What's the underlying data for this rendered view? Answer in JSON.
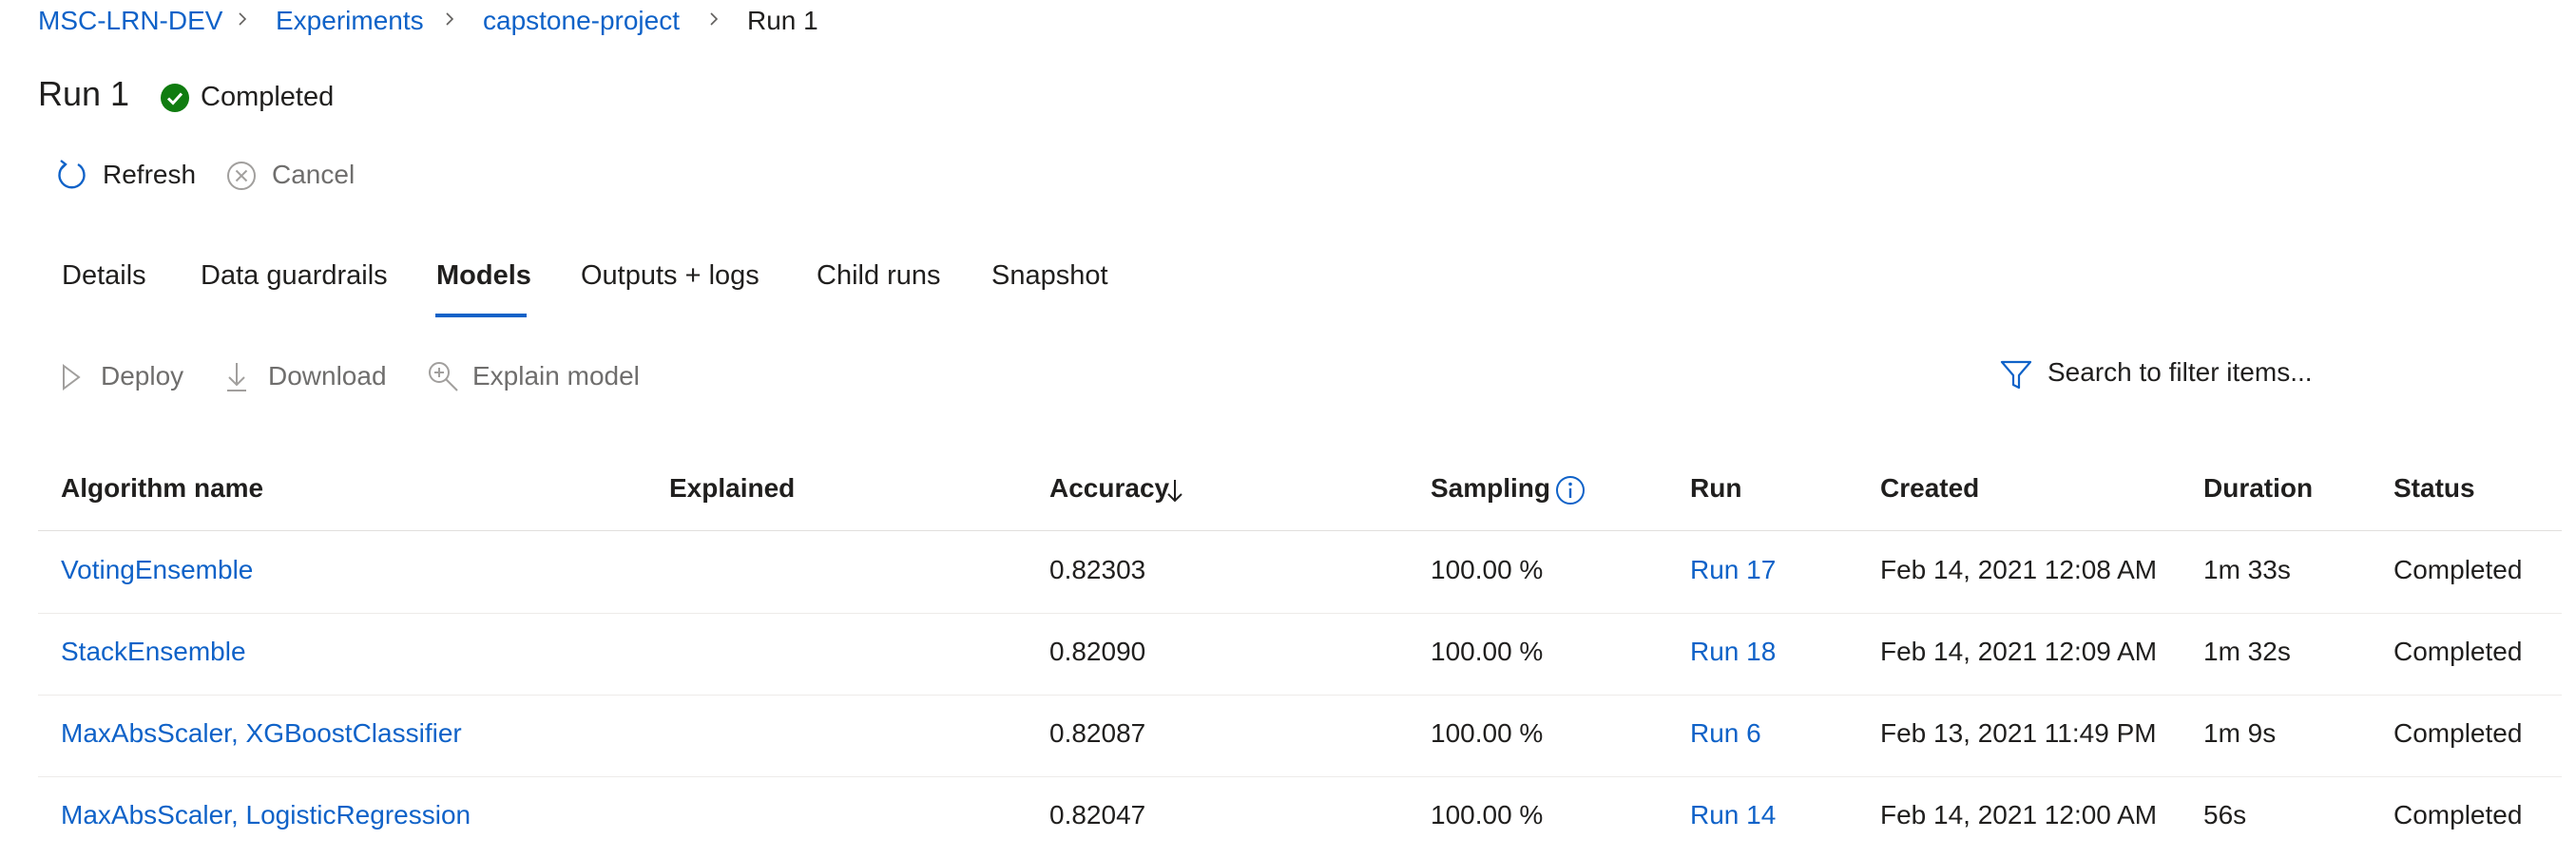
{
  "breadcrumb": {
    "items": [
      "MSC-LRN-DEV",
      "Experiments",
      "capstone-project",
      "Run 1"
    ]
  },
  "header": {
    "title": "Run 1",
    "status": "Completed",
    "status_color": "#107c10"
  },
  "commands": {
    "refresh_label": "Refresh",
    "cancel_label": "Cancel"
  },
  "tabs": [
    {
      "label": "Details"
    },
    {
      "label": "Data guardrails"
    },
    {
      "label": "Models",
      "selected": true
    },
    {
      "label": "Outputs + logs"
    },
    {
      "label": "Child runs"
    },
    {
      "label": "Snapshot"
    }
  ],
  "toolbar": {
    "deploy_label": "Deploy",
    "download_label": "Download",
    "explain_label": "Explain model",
    "search_placeholder": "Search to filter items..."
  },
  "table": {
    "columns": [
      "Algorithm name",
      "Explained",
      "Accuracy",
      "Sampling",
      "Run",
      "Created",
      "Duration",
      "Status"
    ],
    "rows": [
      {
        "algorithm": "VotingEnsemble",
        "explained": "",
        "accuracy": "0.82303",
        "sampling": "100.00 %",
        "run": "Run 17",
        "created": "Feb 14, 2021 12:08 AM",
        "duration": "1m 33s",
        "status": "Completed"
      },
      {
        "algorithm": "StackEnsemble",
        "explained": "",
        "accuracy": "0.82090",
        "sampling": "100.00 %",
        "run": "Run 18",
        "created": "Feb 14, 2021 12:09 AM",
        "duration": "1m 32s",
        "status": "Completed"
      },
      {
        "algorithm": "MaxAbsScaler, XGBoostClassifier",
        "explained": "",
        "accuracy": "0.82087",
        "sampling": "100.00 %",
        "run": "Run 6",
        "created": "Feb 13, 2021 11:49 PM",
        "duration": "1m 9s",
        "status": "Completed"
      },
      {
        "algorithm": "MaxAbsScaler, LogisticRegression",
        "explained": "",
        "accuracy": "0.82047",
        "sampling": "100.00 %",
        "run": "Run 14",
        "created": "Feb 14, 2021 12:00 AM",
        "duration": "56s",
        "status": "Completed"
      }
    ]
  },
  "colors": {
    "accent": "#0f62c8",
    "success": "#107c10",
    "text": "#201f1e",
    "disabled": "#6f6e6d"
  }
}
